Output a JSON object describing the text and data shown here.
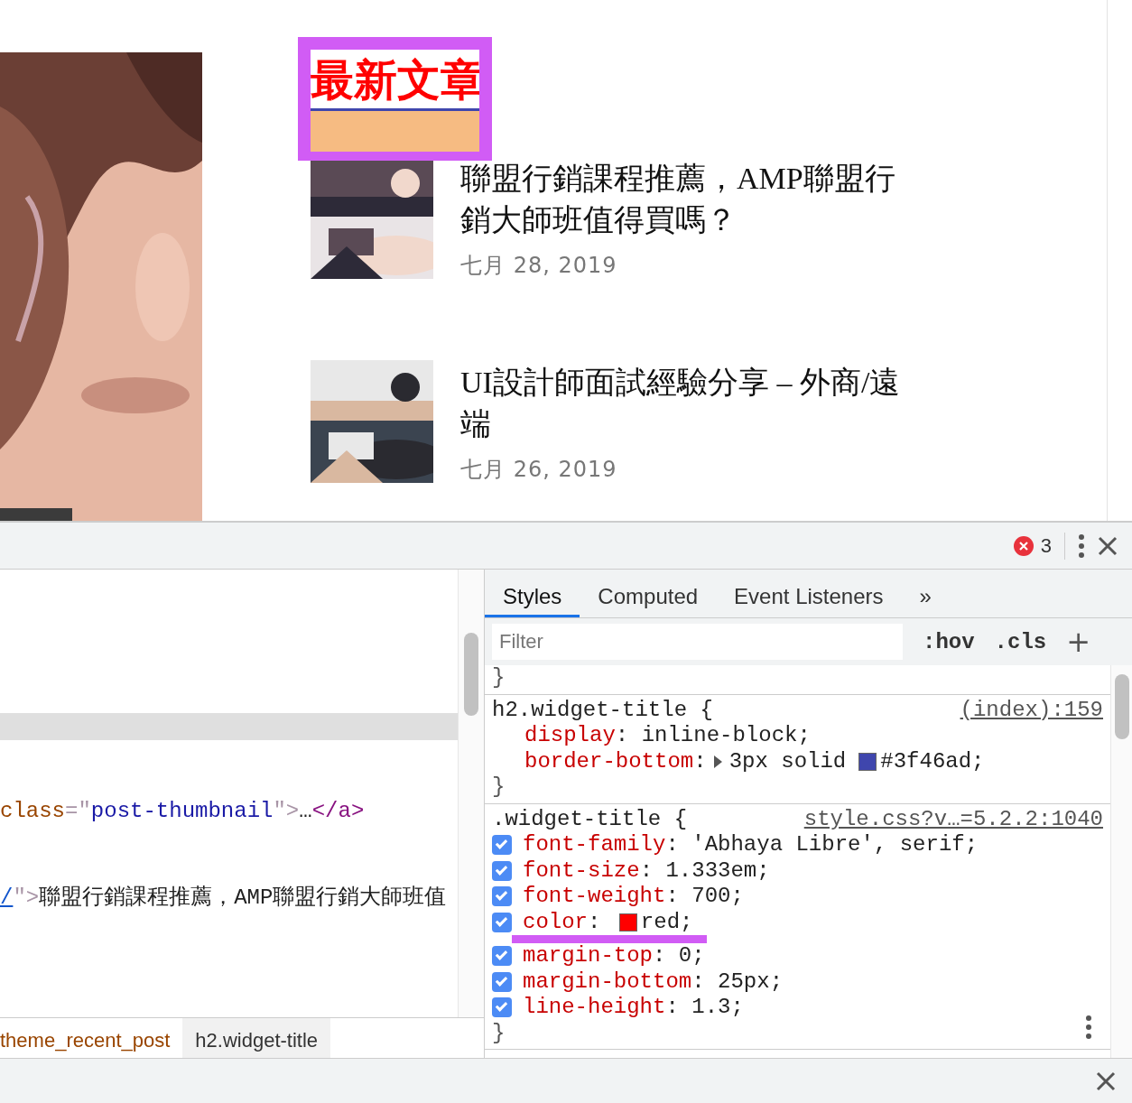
{
  "page": {
    "widget_title": {
      "text": "最新文章",
      "highlighted": true
    },
    "overlay": {
      "kind": "box"
    },
    "posts": [
      {
        "title": "聯盟行銷課程推薦，AMP聯盟行銷大師班值得買嗎？",
        "date": "七月 28, 2019"
      },
      {
        "title": "UI設計師面試經驗分享 – 外商/遠端",
        "date": "七月 26, 2019"
      }
    ]
  },
  "devtools": {
    "error_count": "3",
    "elements": {
      "lines": [
        {
          "selected": true
        },
        {
          "selected": false,
          "parts": [
            {
              "kind": "name",
              "text": "class"
            },
            {
              "kind": "punct",
              "text": "=\""
            },
            {
              "kind": "value",
              "text": "post-thumbnail"
            },
            {
              "kind": "punct",
              "text": "\">"
            },
            {
              "kind": "text",
              "text": "…"
            },
            {
              "kind": "tag",
              "text": "</a>"
            }
          ]
        },
        {
          "selected": false,
          "parts": [
            {
              "kind": "link",
              "text": "/"
            },
            {
              "kind": "punct",
              "text": "\">"
            },
            {
              "kind": "text",
              "text": "聯盟行銷課程推薦，AMP聯盟行銷大師班值"
            }
          ]
        }
      ],
      "breadcrumbs": [
        {
          "label": "theme_recent_post",
          "selected": false
        },
        {
          "label": "h2.widget-title",
          "selected": true
        }
      ]
    },
    "styles": {
      "tabs": [
        {
          "label": "Styles",
          "selected": true
        },
        {
          "label": "Computed",
          "selected": false
        },
        {
          "label": "Event Listeners",
          "selected": false
        }
      ],
      "more": "»",
      "filter": {
        "placeholder": "Filter"
      },
      "hov": ":hov",
      "cls": ".cls",
      "add": "+",
      "rules": [
        {
          "close": "}"
        },
        {
          "selector": "h2.widget-title {",
          "source": "(index):159",
          "declarations": [
            {
              "property": "display",
              "colon": ":",
              "value": "inline-block;"
            },
            {
              "property": "border-bottom",
              "colon": ":",
              "expandable": true,
              "value": "3px solid",
              "swatch": true,
              "swatch_value": "#3f46ad;"
            }
          ],
          "close": "}"
        },
        {
          "selector": ".widget-title {",
          "source": "style.css?v…=5.2.2:1040",
          "declarations": [
            {
              "property": "font-family",
              "colon": ":",
              "value": "'Abhaya Libre', serif;",
              "checked": true
            },
            {
              "property": "font-size",
              "colon": ":",
              "value": "1.333em;",
              "checked": true
            },
            {
              "property": "font-weight",
              "colon": ":",
              "value": "700;",
              "checked": true
            },
            {
              "property": "color",
              "colon": ":",
              "swatch": true,
              "swatch_value": "red;",
              "checked": true,
              "overlay": {
                "kind": "underline"
              }
            },
            {
              "property": "margin-top",
              "colon": ":",
              "value": "0;",
              "checked": true
            },
            {
              "property": "margin-bottom",
              "colon": ":",
              "value": "25px;",
              "checked": true
            },
            {
              "property": "line-height",
              "colon": ":",
              "value": "1.3;",
              "checked": true
            }
          ],
          "close": "}",
          "menu": true
        }
      ]
    }
  }
}
